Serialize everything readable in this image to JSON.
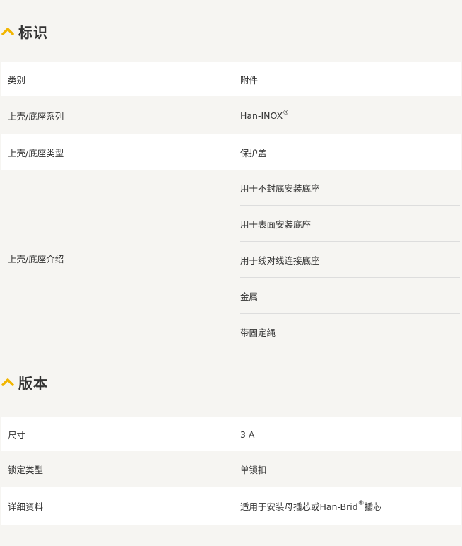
{
  "sections": [
    {
      "title": "标识",
      "icon": "chevron-up-icon",
      "rows": [
        {
          "label": "类别",
          "value": "附件"
        },
        {
          "label": "上壳/底座系列",
          "value": "Han-INOX",
          "sup": "®"
        },
        {
          "label": "上壳/底座类型",
          "value": "保护盖"
        },
        {
          "label": "上壳/底座介绍",
          "values": [
            "用于不封底安装底座",
            "用于表面安装底座",
            "用于线对线连接底座",
            "金属",
            "带固定绳"
          ]
        }
      ]
    },
    {
      "title": "版本",
      "icon": "chevron-up-icon",
      "rows": [
        {
          "label": "尺寸",
          "value": "3 A"
        },
        {
          "label": "锁定类型",
          "value": "单锁扣"
        },
        {
          "label": "详细资料",
          "value": "适用于安装母插芯或Han-Brid",
          "sup": "®",
          "value_suffix": "插芯"
        }
      ]
    }
  ],
  "colors": {
    "accent": "#f2b500",
    "row_white": "#ffffff",
    "row_gray": "#f6f5f2",
    "text": "#333333"
  }
}
